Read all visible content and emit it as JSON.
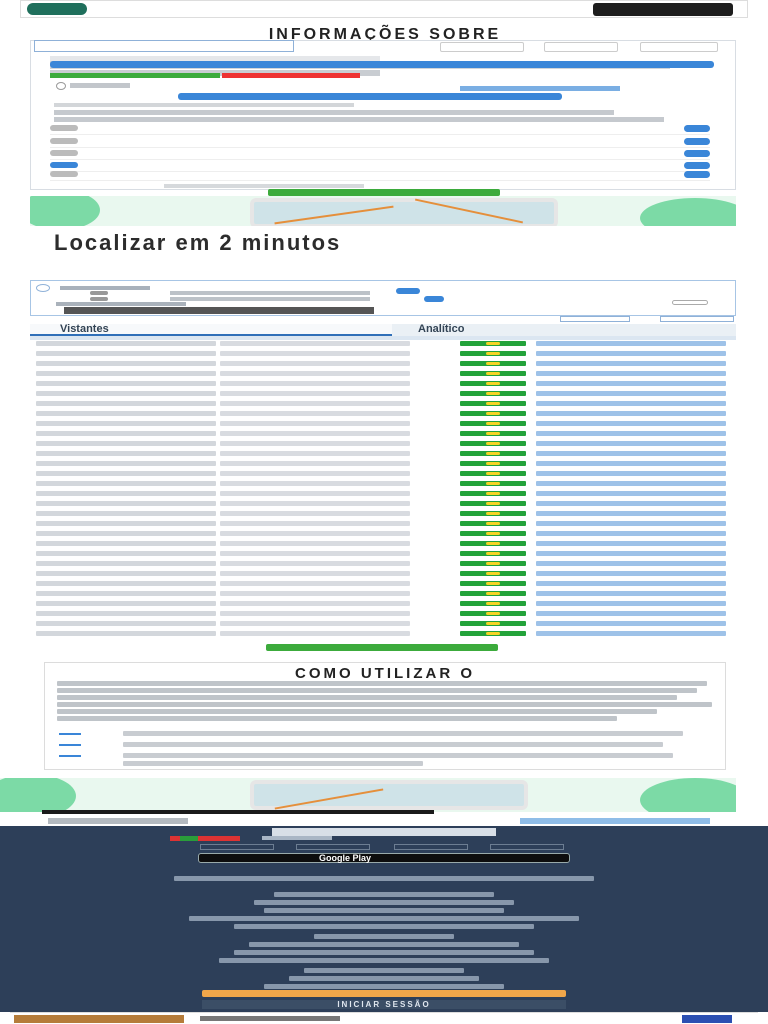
{
  "top_ad": {
    "cta": ""
  },
  "info_section": {
    "title": "INFORMAÇÕES SOBRE",
    "title2": "",
    "export_label": "",
    "toggles": [
      {
        "state": "",
        "on": false,
        "new_badge": ""
      },
      {
        "state": "",
        "on": false,
        "new_badge": ""
      },
      {
        "state": "",
        "on": false,
        "new_badge": ""
      },
      {
        "state": "",
        "on": true,
        "new_badge": ""
      },
      {
        "state": "",
        "on": false,
        "new_badge": ""
      }
    ]
  },
  "locate": {
    "heading": "Localizar em 2 minutos",
    "subheading": "",
    "sub2": ""
  },
  "filters": {
    "count_label": ""
  },
  "table": {
    "tab_visitors": "Vistantes",
    "tab_analytics": "Analítico",
    "row_count": 30
  },
  "howto": {
    "title": "COMO UTILIZAR O"
  },
  "footer": {
    "brand": "",
    "gplay": "Google Play",
    "login": "INICIAR SESSÃO"
  },
  "colors": {
    "accent_blue": "#3a86d8",
    "green": "#3cab3c",
    "footer_bg": "#2d3f59",
    "new_badge": "#e33333",
    "orange": "#f0a64a"
  }
}
